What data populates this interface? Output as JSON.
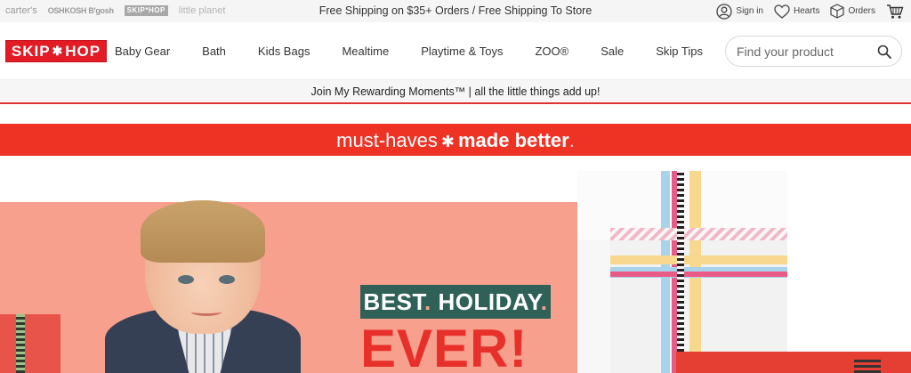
{
  "brands": [
    "carter's",
    "OSHKOSH B'gosh",
    "SKIP*HOP",
    "little planet"
  ],
  "promo": "Free Shipping on $35+ Orders / Free Shipping To Store",
  "account": {
    "signin": "Sign in",
    "hearts": "Hearts",
    "orders": "Orders"
  },
  "logo": {
    "left": "SKIP",
    "star": "✱",
    "right": "HOP"
  },
  "nav": [
    "Baby Gear",
    "Bath",
    "Kids Bags",
    "Mealtime",
    "Playtime & Toys",
    "ZOO®",
    "Sale",
    "Skip Tips"
  ],
  "search": {
    "placeholder": "Find your product"
  },
  "rewards": "Join My Rewarding Moments™  |  all the little things add up!",
  "banner": {
    "part1": "must-haves",
    "star": "✱",
    "part2": "made better",
    "dot": "."
  },
  "hero": {
    "best": "BEST",
    "dot1": ".",
    "holiday": " HOLIDAY",
    "dot2": ".",
    "ever": "EVER!"
  },
  "colors": {
    "brand_red": "#e21b25",
    "banner_red": "#ee3224",
    "hero_salmon": "#f7a08d",
    "tag_green": "#2f6158"
  }
}
